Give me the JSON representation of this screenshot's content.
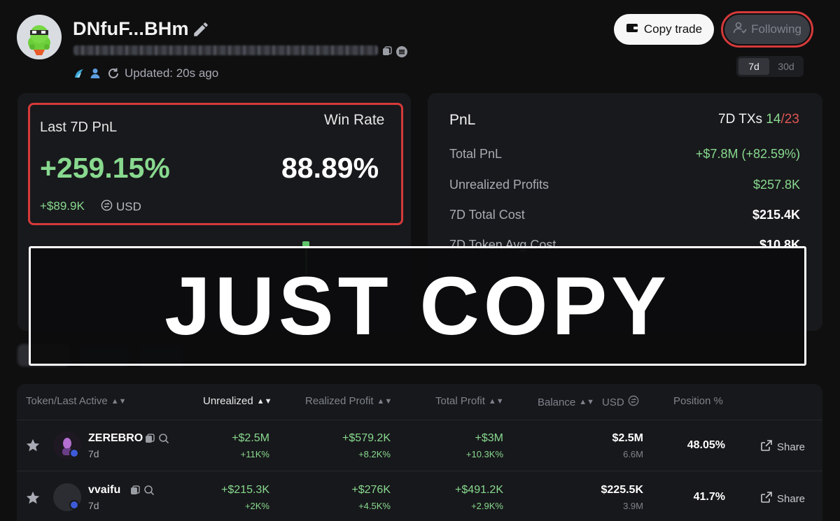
{
  "profile": {
    "name": "DNfuF...BHm",
    "updated": "Updated: 20s ago"
  },
  "actions": {
    "copy_trade": "Copy trade",
    "following": "Following"
  },
  "period": {
    "options": [
      "7d",
      "30d"
    ],
    "selected": "7d"
  },
  "summary": {
    "last_label": "Last 7D PnL",
    "last_value": "+259.15%",
    "last_usd": "+$89.9K",
    "currency": "USD",
    "win_label": "Win Rate",
    "win_value": "88.89%"
  },
  "pnl": {
    "title": "PnL",
    "tx_label": "7D TXs",
    "tx_win": "14",
    "tx_sep": "/",
    "tx_total": "23",
    "rows": [
      {
        "label": "Total PnL",
        "value": "+$7.8M (+82.59%)"
      },
      {
        "label": "Unrealized Profits",
        "value": "$257.8K"
      },
      {
        "label": "7D Total Cost",
        "value": "$215.4K"
      },
      {
        "label": "7D Token Avg Cost",
        "value": "$10.8K"
      }
    ]
  },
  "banner": {
    "text": "JUST COPY"
  },
  "table": {
    "headers": {
      "token": "Token/Last Active",
      "unrealized": "Unrealized",
      "realized": "Realized Profit",
      "total": "Total Profit",
      "balance": "Balance",
      "usd": "USD",
      "position": "Position %"
    },
    "share_label": "Share",
    "rows": [
      {
        "token": "ZEREBRO",
        "last_active": "7d",
        "unrealized": "+$2.5M",
        "unrealized_pct": "+11K%",
        "realized": "+$579.2K",
        "realized_pct": "+8.2K%",
        "total": "+$3M",
        "total_pct": "+10.3K%",
        "balance_usd": "$2.5M",
        "balance_amt": "6.6M",
        "position": "48.05%"
      },
      {
        "token": "vvaifu",
        "last_active": "7d",
        "unrealized": "+$215.3K",
        "unrealized_pct": "+2K%",
        "realized": "+$276K",
        "realized_pct": "+4.5K%",
        "total": "+$491.2K",
        "total_pct": "+2.9K%",
        "balance_usd": "$225.5K",
        "balance_amt": "3.9M",
        "position": "41.7%"
      }
    ]
  },
  "colors": {
    "positive": "#88d98f",
    "negative": "#e05656",
    "highlight": "#d53a3a"
  }
}
